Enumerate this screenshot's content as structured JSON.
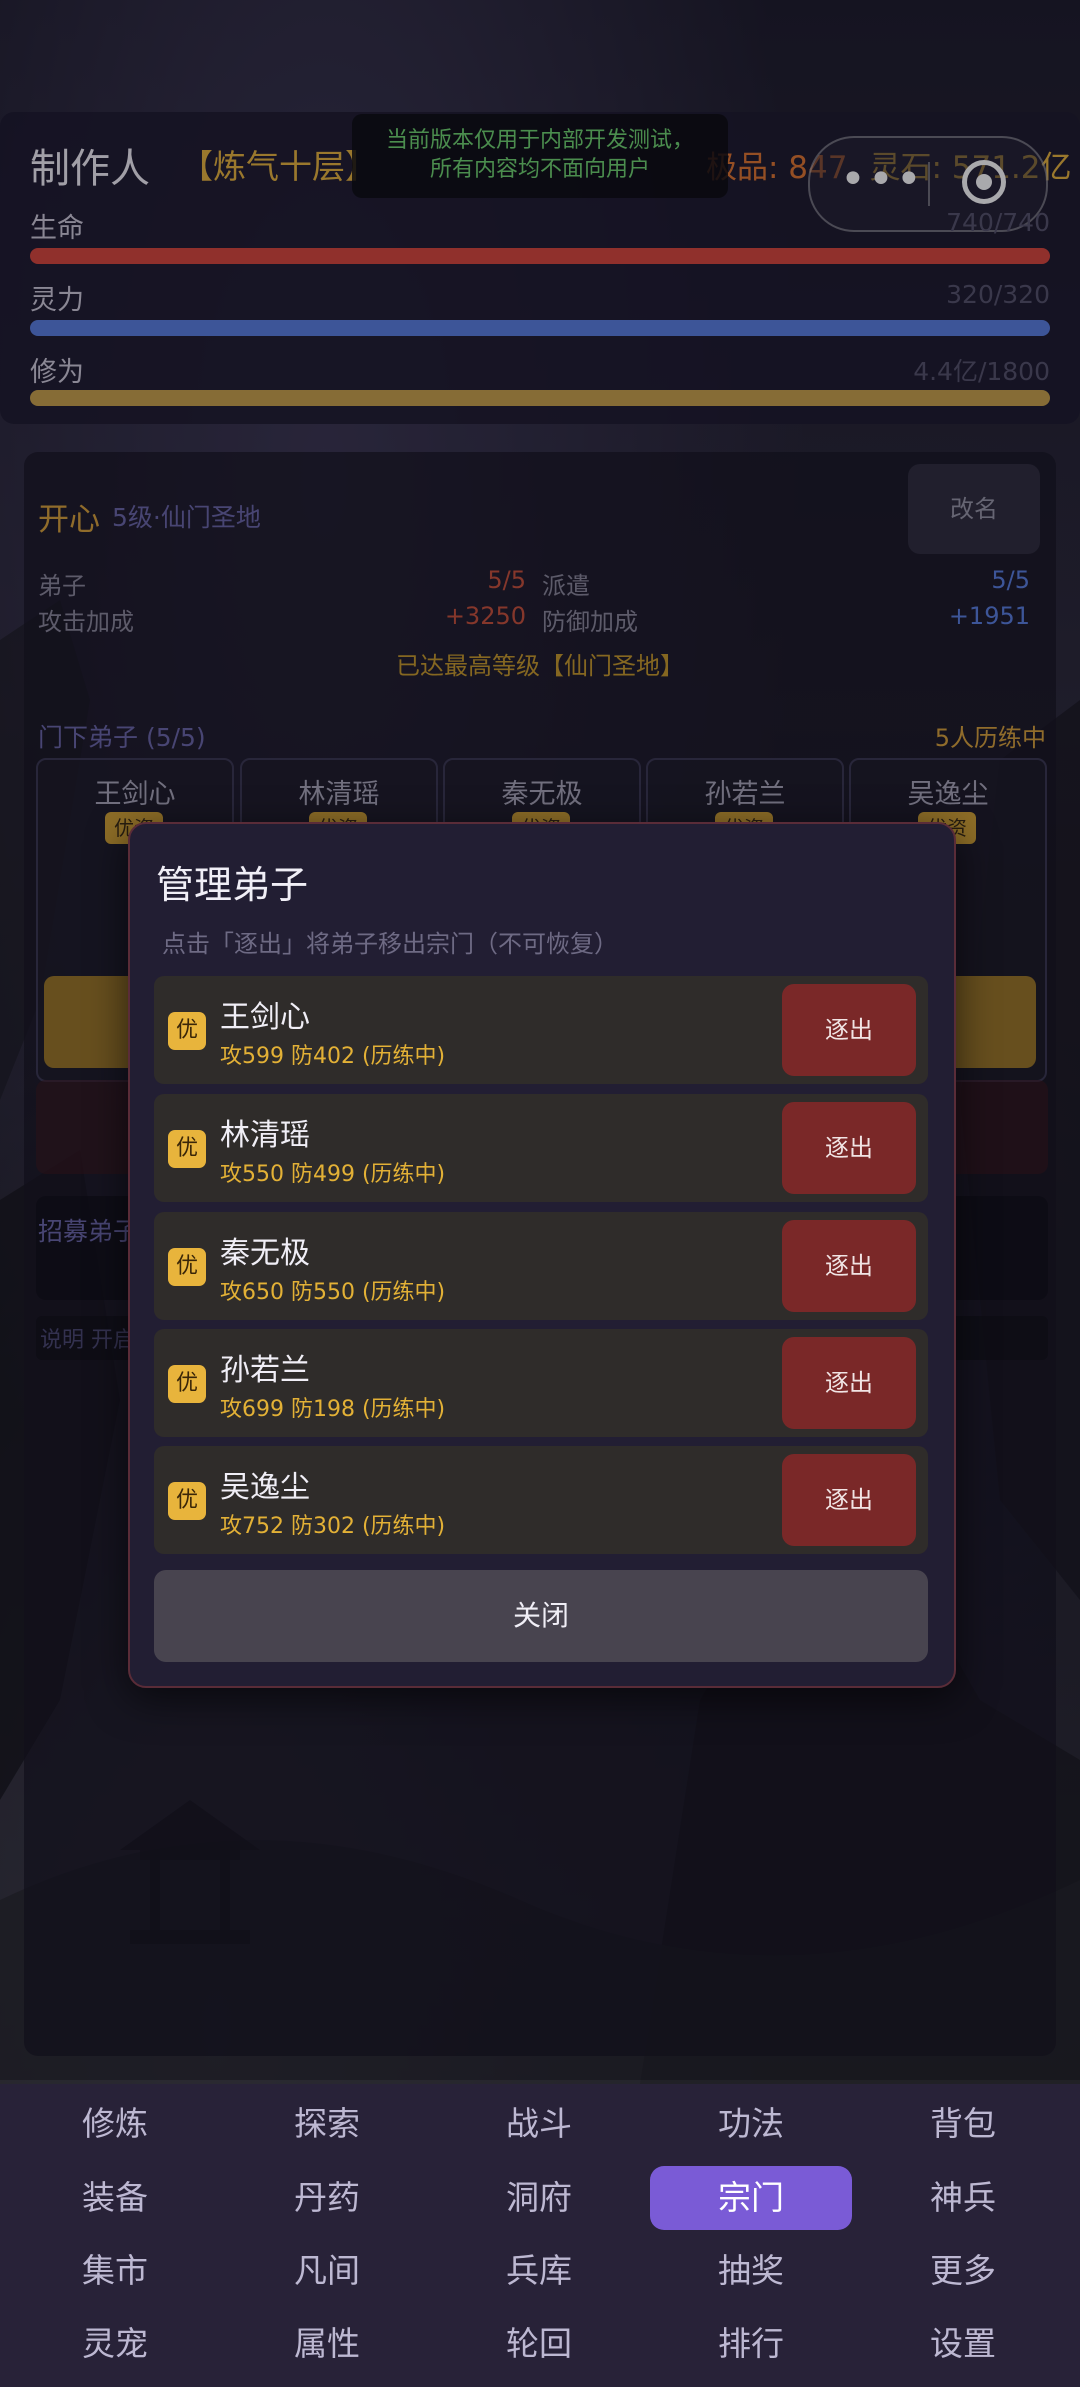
{
  "header": {
    "player_name": "制作人",
    "realm": "【炼气十层】",
    "dev_notice_line1": "当前版本仅用于内部开发测试，",
    "dev_notice_line2": "所有内容均不面向用户",
    "currency_a": "极品: 847",
    "currency_b": "灵石: 571.2亿"
  },
  "stats": [
    {
      "label": "生命",
      "value": "740/740",
      "color": "#d9453b",
      "fill": 1.0
    },
    {
      "label": "灵力",
      "value": "320/320",
      "color": "#5a7fe0",
      "fill": 1.0
    },
    {
      "label": "修为",
      "value": "4.4亿/1800",
      "color": "#c9a24a",
      "fill": 1.0
    }
  ],
  "sect": {
    "name": "开心",
    "level": "5级·仙门圣地",
    "rename_label": "改名",
    "disciples_label": "弟子",
    "disciples_value": "5/5",
    "dispatch_label": "派遣",
    "dispatch_value": "5/5",
    "attack_label": "攻击加成",
    "attack_value": "+3250",
    "defense_label": "防御加成",
    "defense_value": "+1951",
    "max_level_text": "已达最高等级【仙门圣地】",
    "members_title": "门下弟子 (5/5)",
    "members_status": "5人历练中",
    "recruit_title": "招募弟子",
    "note_text": "说明  开启"
  },
  "member_cards": [
    {
      "name": "王剑心",
      "tag": "优资"
    },
    {
      "name": "林清瑶",
      "tag": "优资"
    },
    {
      "name": "秦无极",
      "tag": "优资"
    },
    {
      "name": "孙若兰",
      "tag": "优资"
    },
    {
      "name": "吴逸尘",
      "tag": "优资"
    }
  ],
  "modal": {
    "title": "管理弟子",
    "description": "点击「逐出」将弟子移出宗门（不可恢复）",
    "close_label": "关闭",
    "disciples": [
      {
        "tag": "优",
        "name": "王剑心",
        "stats": "攻599 防402 (历练中)",
        "action": "逐出"
      },
      {
        "tag": "优",
        "name": "林清瑶",
        "stats": "攻550 防499 (历练中)",
        "action": "逐出"
      },
      {
        "tag": "优",
        "name": "秦无极",
        "stats": "攻650 防550 (历练中)",
        "action": "逐出"
      },
      {
        "tag": "优",
        "name": "孙若兰",
        "stats": "攻699 防198 (历练中)",
        "action": "逐出"
      },
      {
        "tag": "优",
        "name": "吴逸尘",
        "stats": "攻752 防302 (历练中)",
        "action": "逐出"
      }
    ]
  },
  "nav": {
    "active": "宗门",
    "items": [
      "修炼",
      "探索",
      "战斗",
      "功法",
      "背包",
      "装备",
      "丹药",
      "洞府",
      "宗门",
      "神兵",
      "集市",
      "凡间",
      "兵库",
      "抽奖",
      "更多",
      "灵宠",
      "属性",
      "轮回",
      "排行",
      "设置"
    ]
  }
}
